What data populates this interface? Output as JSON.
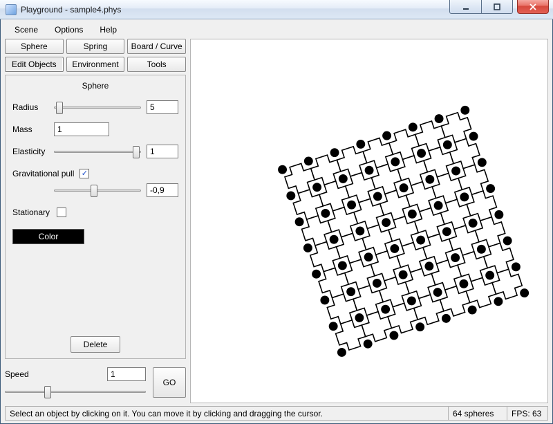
{
  "window": {
    "title": "Playground - sample4.phys"
  },
  "menu": {
    "scene": "Scene",
    "options": "Options",
    "help": "Help"
  },
  "tabs_top": {
    "sphere": "Sphere",
    "spring": "Spring",
    "board": "Board / Curve"
  },
  "tabs_bot": {
    "edit": "Edit Objects",
    "env": "Environment",
    "tools": "Tools"
  },
  "panel": {
    "title": "Sphere",
    "radius_label": "Radius",
    "radius_value": "5",
    "mass_label": "Mass",
    "mass_value": "1",
    "elasticity_label": "Elasticity",
    "elasticity_value": "1",
    "grav_label": "Gravitational pull",
    "grav_checked": "✓",
    "grav_value": "-0,9",
    "stationary_label": "Stationary",
    "color_label": "Color",
    "delete_label": "Delete"
  },
  "speed": {
    "label": "Speed",
    "value": "1",
    "go": "GO"
  },
  "status": {
    "hint": "Select an object by clicking on it. You can move it by clicking and dragging the cursor.",
    "spheres": "64 spheres",
    "fps": "FPS: 63"
  }
}
